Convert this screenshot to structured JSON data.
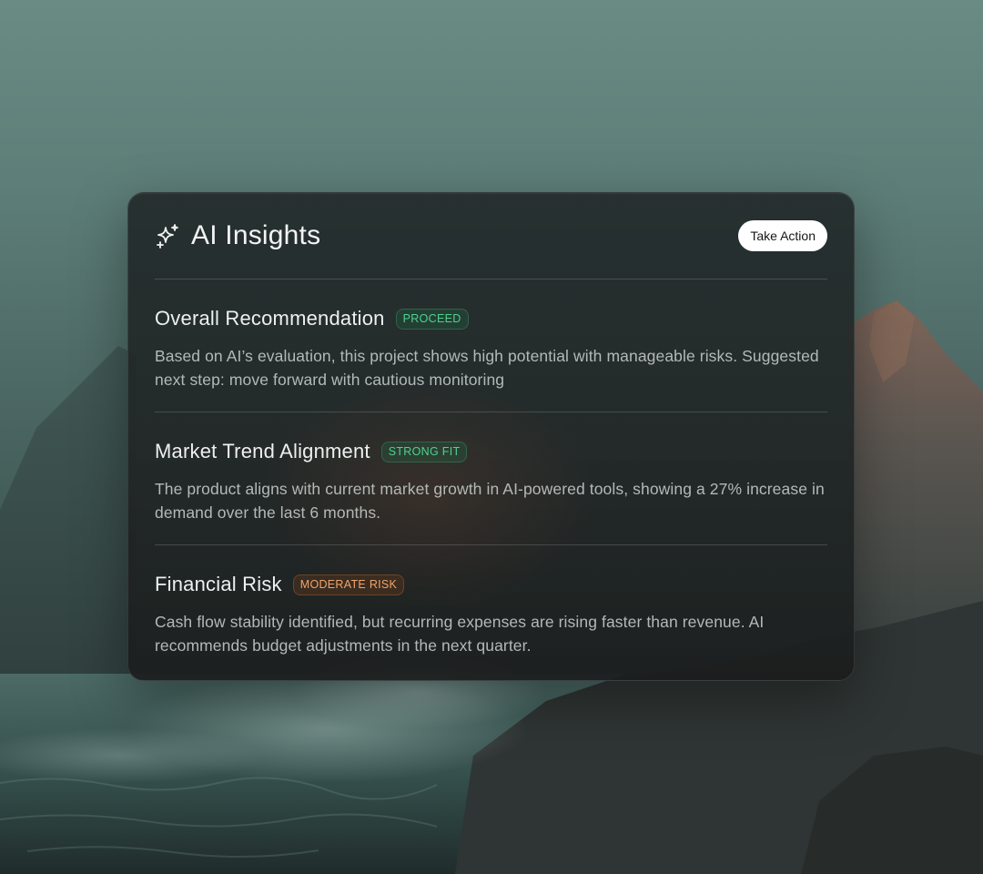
{
  "header": {
    "title": "AI Insights",
    "action_label": "Take Action"
  },
  "sections": [
    {
      "title": "Overall Recommendation",
      "badge": "PROCEED",
      "badge_tone": "green",
      "body": "Based on AI’s evaluation, this project shows high potential with manageable risks. Suggested next step: move forward with cautious monitoring"
    },
    {
      "title": "Market Trend Alignment",
      "badge": "STRONG FIT",
      "badge_tone": "green",
      "body": "The product aligns with current market growth in AI-powered tools, showing a 27% increase in demand over the last 6 months."
    },
    {
      "title": "Financial Risk",
      "badge": "MODERATE RISK",
      "badge_tone": "orange",
      "body": "Cash flow stability identified, but recurring expenses are rising faster than revenue. AI recommends budget adjustments in the next quarter."
    }
  ],
  "colors": {
    "badge_green": "#4fd18f",
    "badge_orange": "#f0a36a",
    "card_bg": "#222a2a",
    "button_bg": "#ffffff"
  },
  "icons": {
    "title_icon": "sparkle-icon"
  }
}
